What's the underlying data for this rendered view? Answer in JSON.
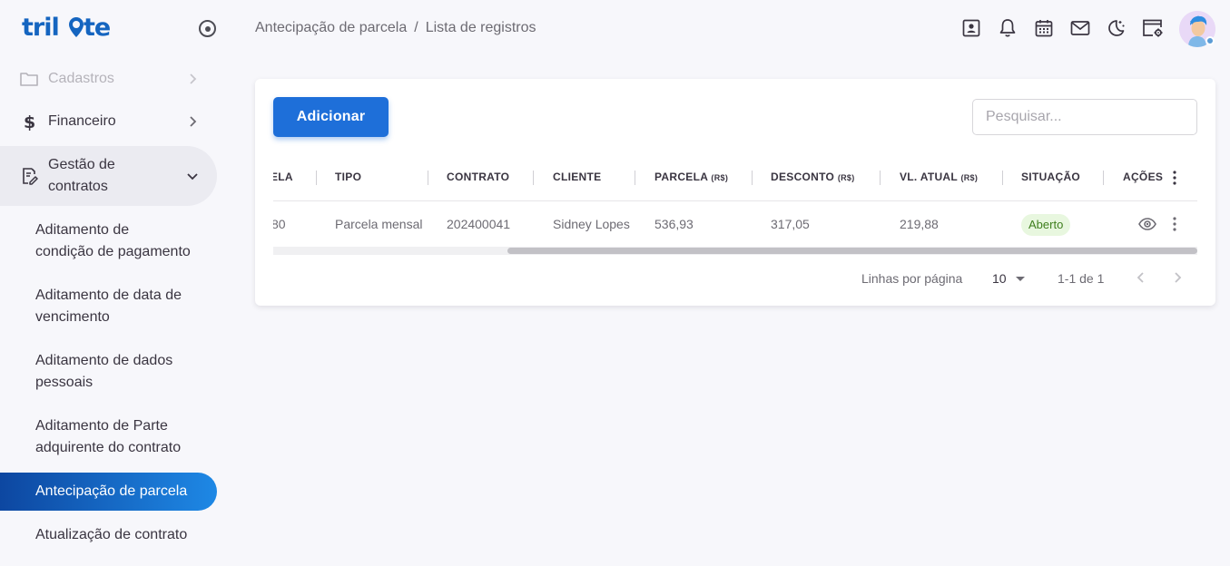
{
  "brand": {
    "name": "trilote"
  },
  "sidebar": {
    "items": [
      {
        "label": "Cadastros",
        "icon": "folder-icon"
      },
      {
        "label": "Financeiro",
        "icon": "dollar-icon"
      },
      {
        "label": "Gestão de contratos",
        "label_line1": "Gestão de",
        "label_line2": "contratos",
        "icon": "contract-edit-icon"
      }
    ],
    "subitems": [
      {
        "line1": "Aditamento de",
        "line2": "condição de pagamento"
      },
      {
        "line1": "Aditamento de data de",
        "line2": "vencimento"
      },
      {
        "line1": "Aditamento de dados",
        "line2": "pessoais"
      },
      {
        "line1": "Aditamento de Parte",
        "line2": "adquirente do contrato"
      },
      {
        "line1": "Antecipação de parcela",
        "active": true
      },
      {
        "line1": "Atualização de contrato"
      }
    ]
  },
  "header": {
    "breadcrumb": [
      "Antecipação de parcela",
      "Lista de registros"
    ],
    "separator": "/",
    "icons": [
      "contact-card-icon",
      "bell-icon",
      "calendar-icon",
      "mail-icon",
      "moon-icon",
      "window-settings-icon"
    ]
  },
  "toolbar": {
    "add_label": "Adicionar",
    "search_placeholder": "Pesquisar..."
  },
  "table": {
    "columns": [
      {
        "label": "ELA"
      },
      {
        "label": "TIPO"
      },
      {
        "label": "CONTRATO"
      },
      {
        "label": "CLIENTE"
      },
      {
        "label": "PARCELA",
        "unit": "(R$)"
      },
      {
        "label": "DESCONTO",
        "unit": "(R$)"
      },
      {
        "label": "VL. ATUAL",
        "unit": "(R$)"
      },
      {
        "label": "SITUAÇÃO"
      },
      {
        "label": "AÇÕES"
      }
    ],
    "rows": [
      {
        "parcela_num": "80",
        "tipo": "Parcela mensal",
        "contrato": "202400041",
        "cliente": "Sidney Lopes",
        "parcela": "536,93",
        "desconto": "317,05",
        "vl_atual": "219,88",
        "situacao": "Aberto"
      }
    ]
  },
  "pagination": {
    "rows_per_page_label": "Linhas por página",
    "rows_per_page": "10",
    "range": "1-1 de 1"
  },
  "colors": {
    "primary": "#1e6fd9",
    "active_gradient_start": "#0d47a1",
    "active_gradient_end": "#1e88e5",
    "status_open_bg": "#e8f7df",
    "status_open_text": "#3f7f1e"
  }
}
